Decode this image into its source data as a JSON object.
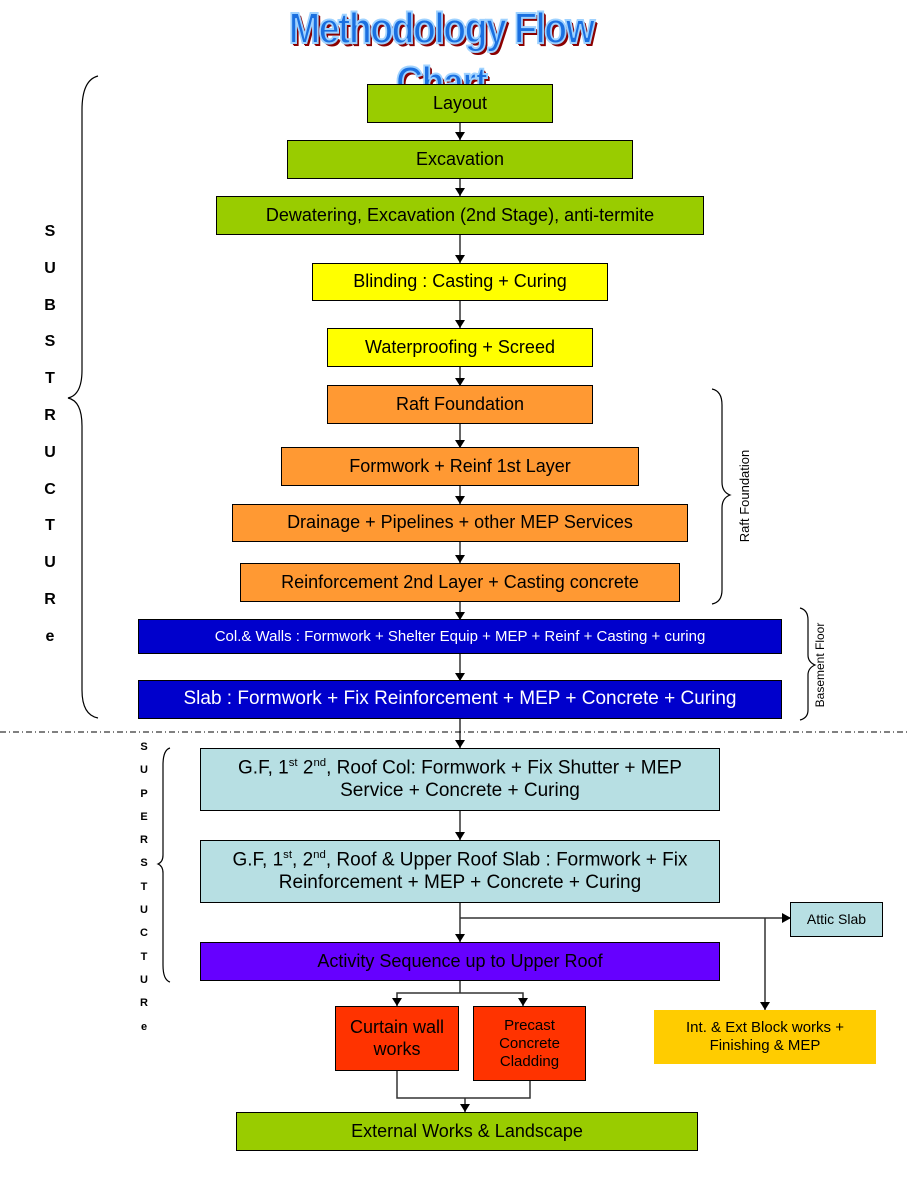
{
  "title": "Methodology Flow Chart",
  "colors": {
    "green": "#99cc00",
    "yellow": "#ffff00",
    "orange": "#ff9933",
    "navy": "#0000cc",
    "cyan": "#b7dfe3",
    "violet": "#6600ff",
    "red": "#ff3300",
    "gold": "#ffcc00",
    "title_blue": "#1a6fe0",
    "title_shadow": "#8b0000"
  },
  "sections": {
    "substructure_letters": [
      "S",
      "U",
      "B",
      "S",
      "T",
      "R",
      "U",
      "C",
      "T",
      "U",
      "R",
      "e"
    ],
    "superstructure_letters": [
      "S",
      "U",
      "P",
      "E",
      "R",
      "S",
      "T",
      "U",
      "C",
      "T",
      "U",
      "R",
      "e"
    ],
    "raft_foundation_label": "Raft Foundation",
    "basement_floor_label": "Basement Floor"
  },
  "steps": {
    "layout": "Layout",
    "excavation": "Excavation",
    "dewatering": "Dewatering, Excavation (2nd Stage), anti-termite",
    "blinding": "Blinding : Casting + Curing",
    "waterproofing": "Waterproofing + Screed",
    "raft_foundation": "Raft Foundation",
    "formwork_reinf": "Formwork + Reinf 1st Layer",
    "drainage": "Drainage + Pipelines + other MEP Services",
    "reinforcement_2nd": "Reinforcement 2nd Layer + Casting concrete",
    "col_walls": "Col.& Walls : Formwork + Shelter Equip + MEP + Reinf + Casting + curing",
    "slab_basement": "Slab : Formwork + Fix Reinforcement + MEP + Concrete + Curing",
    "gf_col": {
      "prefix": "G.F, 1",
      "sup1": "st",
      "mid": " 2",
      "sup2": "nd",
      "suffix": ", Roof Col: Formwork + Fix Shutter + MEP",
      "line2": "Service + Concrete + Curing"
    },
    "gf_slab": {
      "prefix": "G.F, 1",
      "sup1": "st",
      "mid": ", 2",
      "sup2": "nd",
      "suffix": ", Roof & Upper Roof Slab : Formwork + Fix",
      "line2": "Reinforcement + MEP + Concrete + Curing"
    },
    "attic_slab": "Attic Slab",
    "activity_sequence": "Activity Sequence up to Upper Roof",
    "curtain_wall": "Curtain wall works",
    "precast": "Precast Concrete Cladding",
    "block_works": "Int. & Ext Block works + Finishing & MEP",
    "external_works": "External Works & Landscape"
  }
}
